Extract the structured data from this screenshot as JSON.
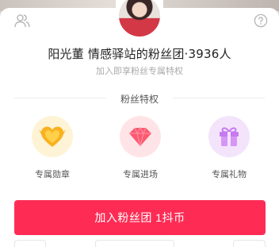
{
  "header": {
    "title": "阳光董 情感驿站的粉丝团·3936人",
    "subtitle": "加入即享粉丝专属特权"
  },
  "section": {
    "title": "粉丝特权"
  },
  "perks": [
    {
      "label": "专属勋章",
      "icon": "gold-heart-badge-icon",
      "color": "#f8b21f"
    },
    {
      "label": "专属进场",
      "icon": "pink-diamond-icon",
      "color": "#fb5a72"
    },
    {
      "label": "专属礼物",
      "icon": "purple-gift-box-icon",
      "color": "#c77af0"
    }
  ],
  "join_button": {
    "label": "加入粉丝团 1抖币",
    "color": "#fe2c55"
  }
}
